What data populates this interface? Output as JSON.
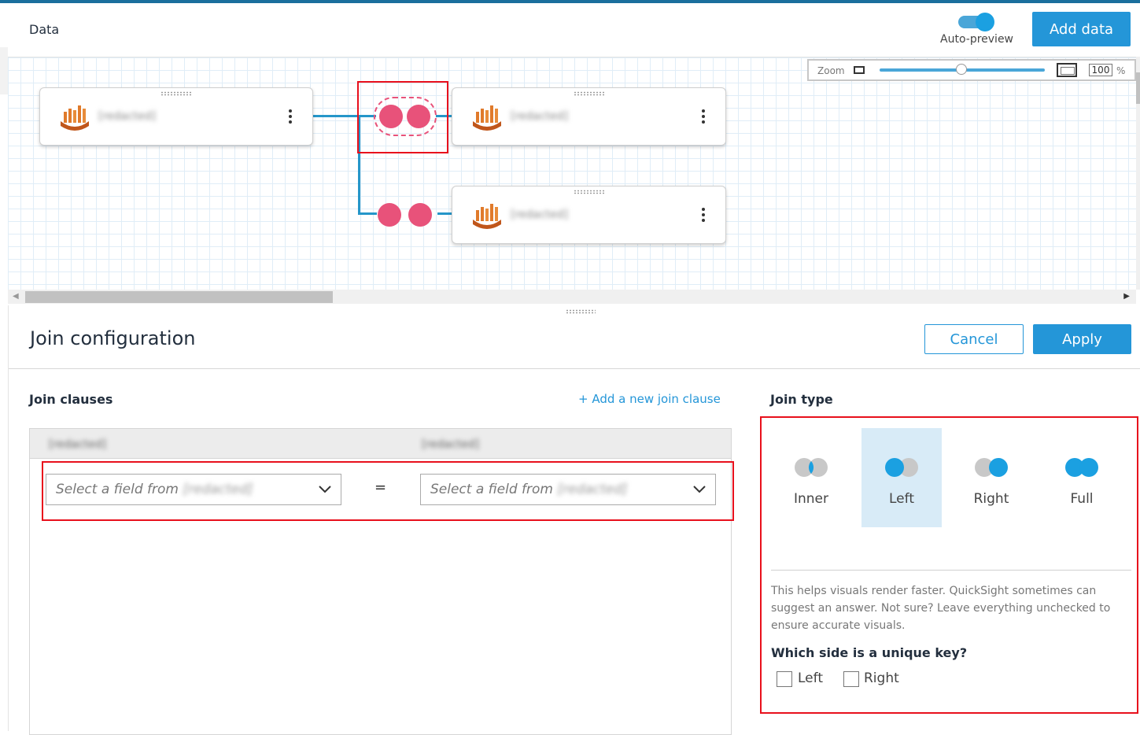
{
  "header": {
    "title": "Data",
    "auto_preview_label": "Auto-preview",
    "add_data_label": "Add data"
  },
  "zoom": {
    "label": "Zoom",
    "value": "100",
    "unit": "%",
    "slider_level_fraction": 0.5
  },
  "canvas": {
    "nodes": [
      {
        "name": "[redacted]"
      },
      {
        "name": "[redacted]"
      },
      {
        "name": "[redacted]"
      }
    ]
  },
  "join_config": {
    "title": "Join configuration",
    "cancel_label": "Cancel",
    "apply_label": "Apply",
    "clauses_heading": "Join clauses",
    "add_clause_label": "+ Add a new join clause",
    "left_table": "[redacted]",
    "right_table": "[redacted]",
    "left_select_placeholder": "Select a field from",
    "right_select_placeholder": "Select a field from",
    "equals": "="
  },
  "join_type": {
    "heading": "Join type",
    "options": [
      {
        "label": "Inner",
        "selected": false
      },
      {
        "label": "Left",
        "selected": true
      },
      {
        "label": "Right",
        "selected": false
      },
      {
        "label": "Full",
        "selected": false
      }
    ],
    "help_text": "This helps visuals render faster. QuickSight sometimes can suggest an answer. Not sure? Leave everything unchecked to ensure accurate visuals.",
    "unique_key_question": "Which side is a unique key?",
    "unique_key_left": "Left",
    "unique_key_right": "Right"
  },
  "colors": {
    "accent": "#2496d8",
    "join_circle": "#e8527a",
    "selected_bg": "#d8ebf7",
    "highlight_box": "#e8101c"
  }
}
